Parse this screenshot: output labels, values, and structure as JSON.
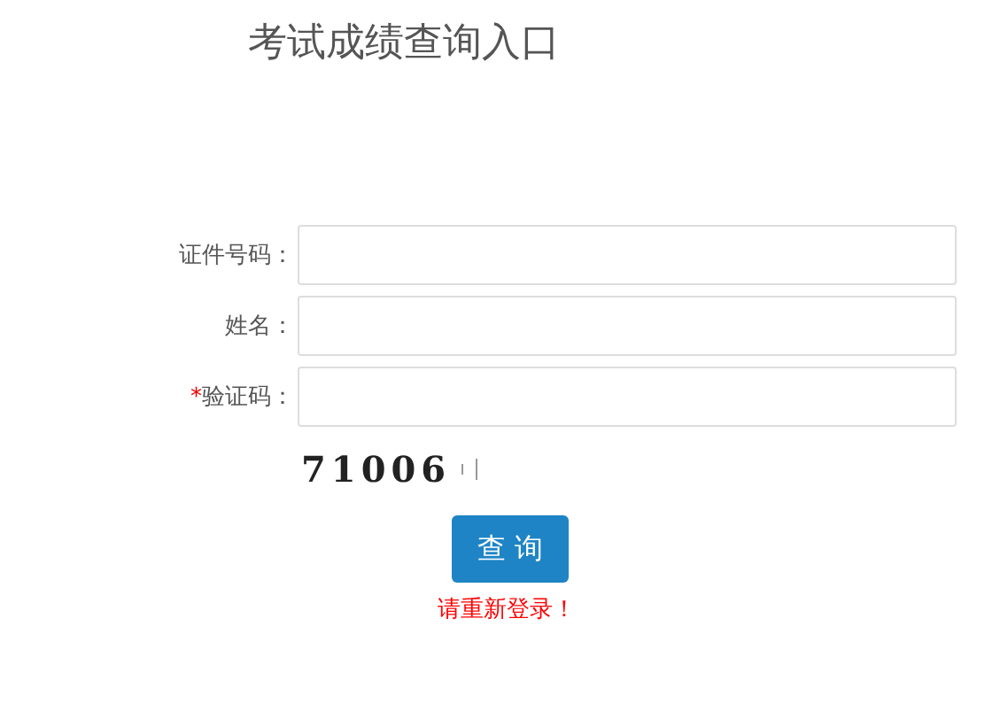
{
  "title": "考试成绩查询入口",
  "fields": [
    {
      "label": "证件号码：",
      "required": false
    },
    {
      "label": "姓名：",
      "required": false
    },
    {
      "label": "验证码：",
      "required": true
    }
  ],
  "required_mark": "*",
  "captcha": "71006",
  "submit": "查 询",
  "error": "请重新登录！"
}
